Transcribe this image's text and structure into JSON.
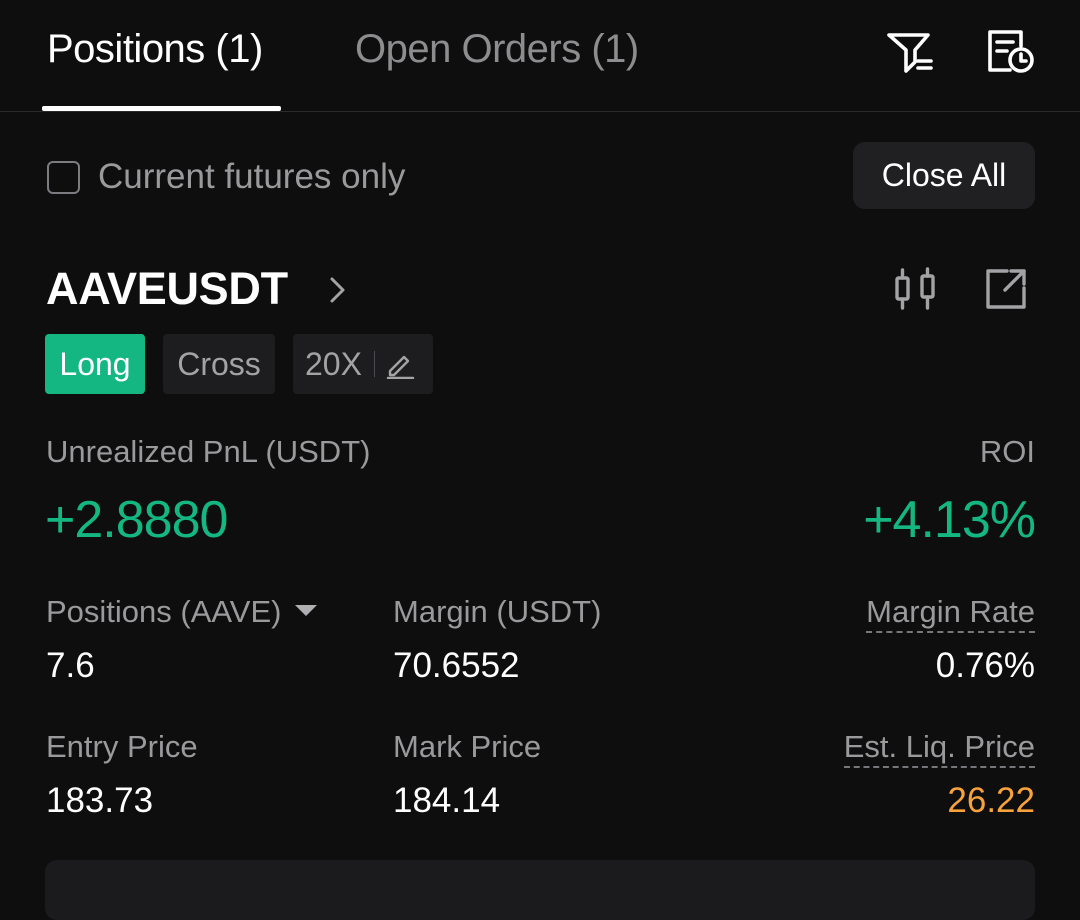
{
  "tabs": {
    "positions": "Positions (1)",
    "open_orders": "Open Orders (1)"
  },
  "toolbar": {
    "filter_icon": "filter-icon",
    "history_icon": "order-history-icon"
  },
  "filter": {
    "current_futures_label": "Current futures only",
    "current_futures_checked": false
  },
  "close_all_label": "Close All",
  "position": {
    "symbol": "AAVEUSDT",
    "side": "Long",
    "margin_mode": "Cross",
    "leverage": "20X",
    "unrealized_pnl_label": "Unrealized PnL (USDT)",
    "unrealized_pnl_value": "+2.8880",
    "roi_label": "ROI",
    "roi_value": "+4.13%",
    "positions_label": "Positions (AAVE)",
    "positions_value": "7.6",
    "margin_label": "Margin (USDT)",
    "margin_value": "70.6552",
    "margin_rate_label": "Margin Rate",
    "margin_rate_value": "0.76%",
    "entry_price_label": "Entry Price",
    "entry_price_value": "183.73",
    "mark_price_label": "Mark Price",
    "mark_price_value": "184.14",
    "liq_price_label": "Est. Liq. Price",
    "liq_price_value": "26.22"
  },
  "colors": {
    "background": "#0e0e0f",
    "positive": "#14b781",
    "warning": "#f7a23b",
    "muted_text": "#9a9a9d"
  }
}
